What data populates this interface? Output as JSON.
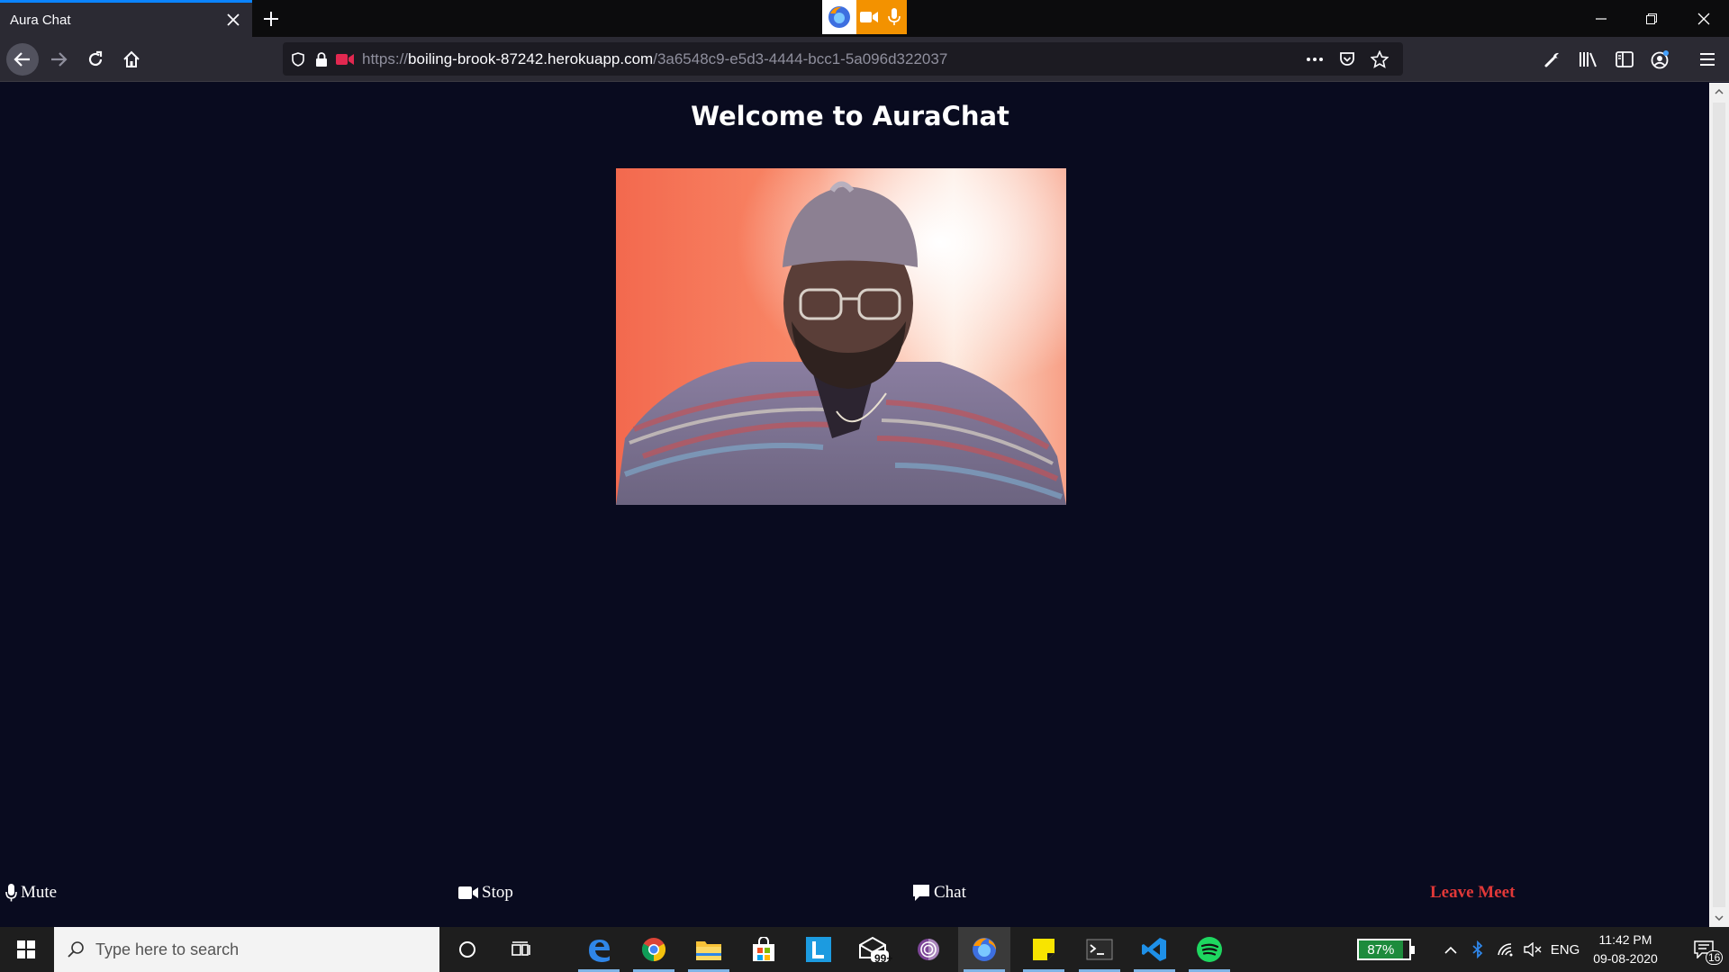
{
  "browser": {
    "tab_title": "Aura Chat",
    "url_scheme": "https://",
    "url_host": "boiling-brook-87242.herokuapp.com",
    "url_path": "/3a6548c9-e5d3-4444-bcc1-5a096d322037"
  },
  "page": {
    "title": "Welcome to AuraChat",
    "video_label": "local webcam video"
  },
  "controls": {
    "mute_label": "Mute",
    "stop_label": "Stop",
    "chat_label": "Chat",
    "leave_label": "Leave Meet"
  },
  "taskbar": {
    "search_placeholder": "Type here to search",
    "mail_badge": "99+",
    "battery_percent": "87%",
    "battery_level": 0.87,
    "language": "ENG",
    "time": "11:42 PM",
    "date": "09-08-2020",
    "notifications": "16"
  },
  "colors": {
    "page_background": "#090b1f",
    "leave_button": "#e03838",
    "sharing_indicator": "#f39200"
  }
}
